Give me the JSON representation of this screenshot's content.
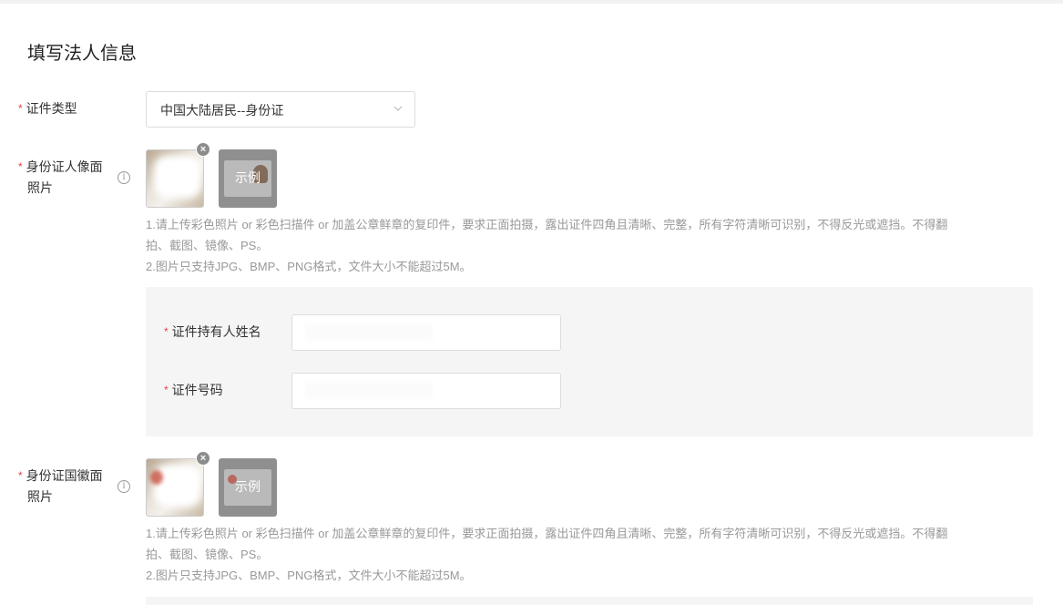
{
  "form": {
    "title": "填写法人信息",
    "required_mark": "*",
    "id_type": {
      "label": "证件类型",
      "selected": "中国大陆居民--身份证"
    },
    "front_photo": {
      "label_line1": "身份证人像面",
      "label_line2": "照片",
      "example_label": "示例",
      "hint_line1": "1.请上传彩色照片 or 彩色扫描件 or 加盖公章鲜章的复印件，要求正面拍摄，露出证件四角且清晰、完整，所有字符清晰可识别，不得反光或遮挡。不得翻",
      "hint_line2": "拍、截图、镜像、PS。",
      "hint_line3": "2.图片只支持JPG、BMP、PNG格式，文件大小不能超过5M。"
    },
    "holder_name": {
      "label": "证件持有人姓名"
    },
    "id_number": {
      "label": "证件号码"
    },
    "back_photo": {
      "label_line1": "身份证国徽面",
      "label_line2": "照片",
      "example_label": "示例",
      "hint_line1": "1.请上传彩色照片 or 彩色扫描件 or 加盖公章鲜章的复印件，要求正面拍摄，露出证件四角且清晰、完整，所有字符清晰可识别，不得反光或遮挡。不得翻",
      "hint_line2": "拍、截图、镜像、PS。",
      "hint_line3": "2.图片只支持JPG、BMP、PNG格式，文件大小不能超过5M。"
    }
  },
  "icons": {
    "info": "i",
    "remove": "×"
  },
  "colors": {
    "required": "#e64545",
    "hint_text": "#999999",
    "panel_bg": "#f5f5f5"
  }
}
